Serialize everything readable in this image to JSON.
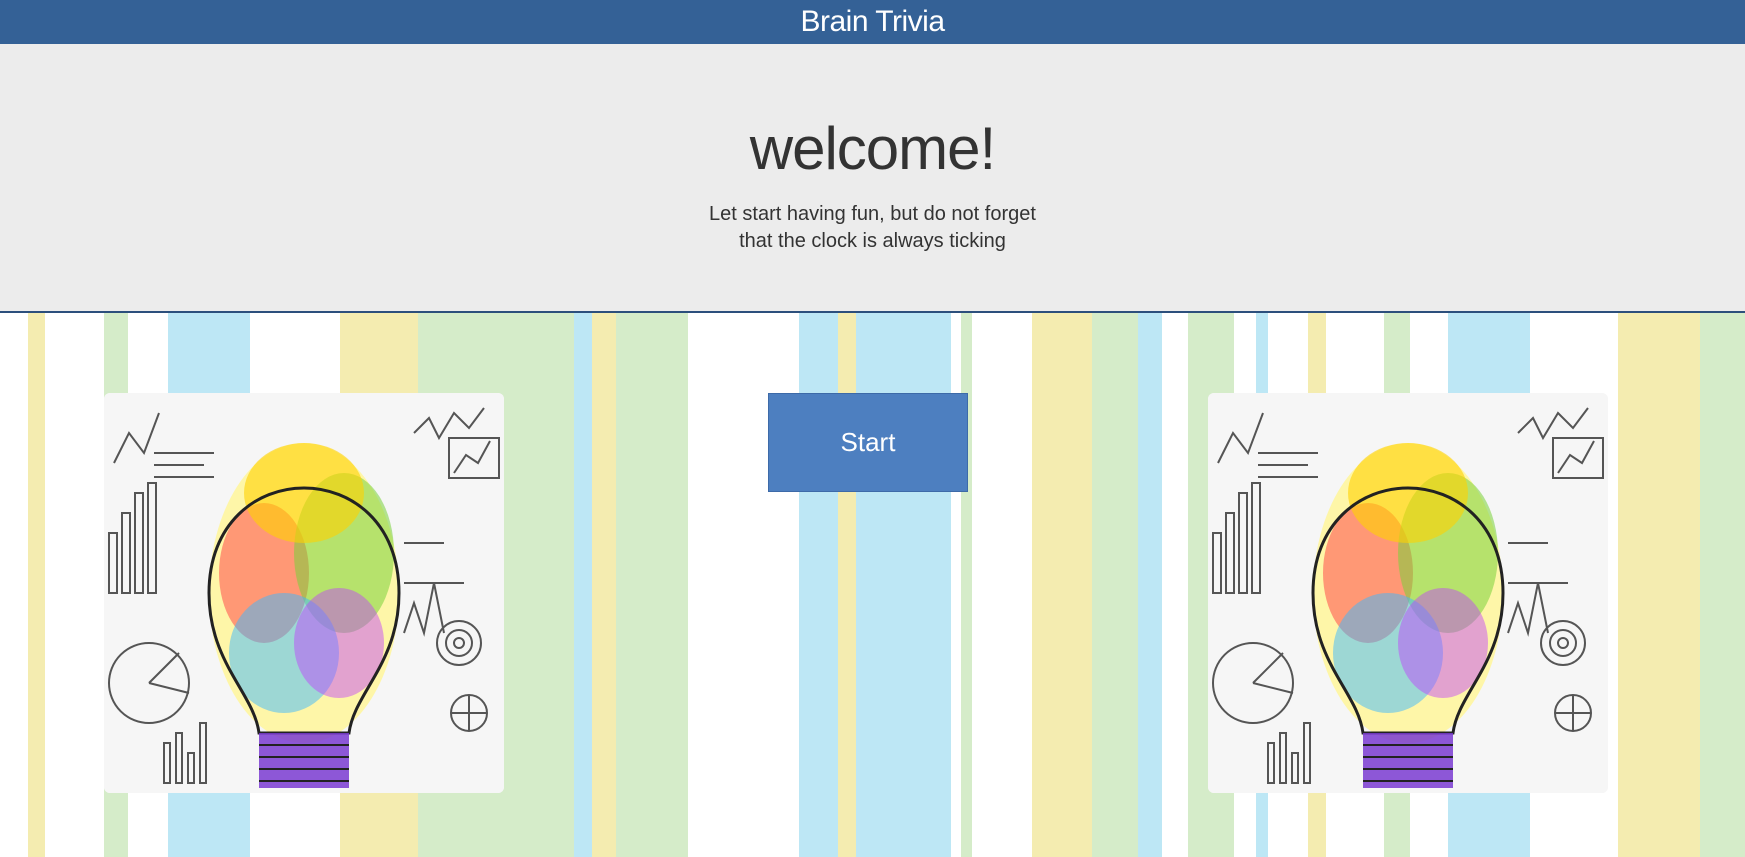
{
  "header": {
    "title": "Brain Trivia"
  },
  "hero": {
    "heading": "welcome!",
    "line1": "Let start having fun, but do not forget",
    "line2": "that the clock is always ticking"
  },
  "actions": {
    "start_label": "Start"
  },
  "colors": {
    "header": "#346196",
    "hero_bg": "#ececec",
    "button": "#4d7fc0",
    "stripe_yellow": "#f4ecb0",
    "stripe_green": "#d5ecc9",
    "stripe_blue": "#bde7f5"
  },
  "images": [
    {
      "name": "lightbulb-illustration-left"
    },
    {
      "name": "lightbulb-illustration-right"
    }
  ]
}
